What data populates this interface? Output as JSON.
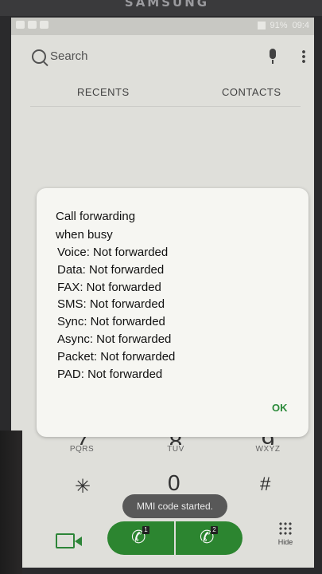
{
  "device": {
    "brand": "SAMSUNG"
  },
  "statusbar": {
    "battery": "91%",
    "time": "09:4"
  },
  "search": {
    "label": "Search"
  },
  "tabs": [
    {
      "label": "RECENTS"
    },
    {
      "label": "CONTACTS"
    }
  ],
  "keypad": {
    "row4": [
      {
        "num": "7",
        "sub": "PQRS"
      },
      {
        "num": "8",
        "sub": "TUV"
      },
      {
        "num": "9",
        "sub": "WXYZ"
      }
    ],
    "bottom": {
      "star": "✳",
      "zero": "0",
      "hash": "#"
    }
  },
  "toast": {
    "text": "MMI code started."
  },
  "actionbar": {
    "call1_sim": "1",
    "call2_sim": "2",
    "hide_label": "Hide"
  },
  "dialog": {
    "title": "Call forwarding\nwhen busy",
    "title_line1": "Call forwarding",
    "title_line2": "when busy",
    "lines": [
      "Voice: Not forwarded",
      "Data: Not forwarded",
      "FAX: Not forwarded",
      "SMS: Not forwarded",
      "Sync: Not forwarded",
      "Async: Not forwarded",
      "Packet: Not forwarded",
      "PAD: Not forwarded"
    ],
    "ok_label": "OK"
  },
  "colors": {
    "accent": "#2e8a32",
    "dialog_bg": "#f6f6f2",
    "screen_bg": "#e7e7e2"
  }
}
